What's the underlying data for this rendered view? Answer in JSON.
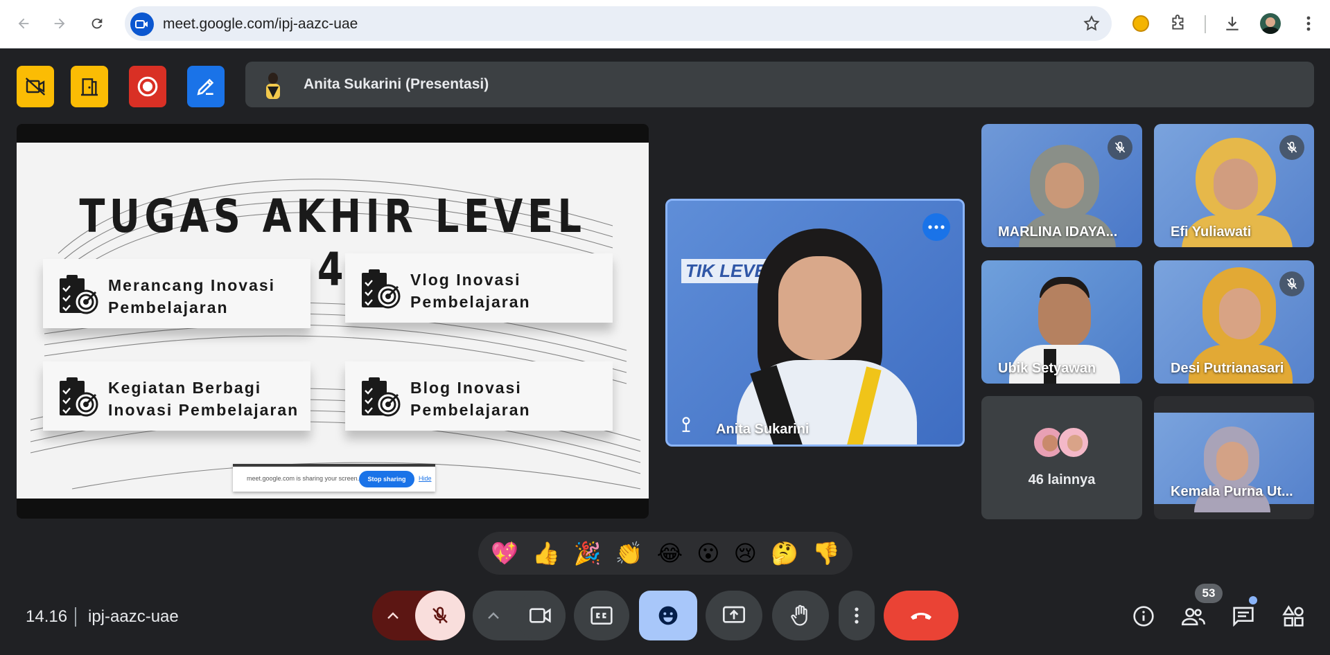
{
  "browser": {
    "url": "meet.google.com/ipj-aazc-uae"
  },
  "meeting": {
    "presenting_label": "Anita Sukarini (Presentasi)",
    "time": "14.16",
    "code": "ipj-aazc-uae",
    "participant_count": "53"
  },
  "slide": {
    "title": "TUGAS AKHIR LEVEL 4",
    "cards": [
      {
        "line1": "Merancang Inovasi",
        "line2": "Pembelajaran"
      },
      {
        "line1": "Vlog Inovasi",
        "line2": "Pembelajaran"
      },
      {
        "line1": "Kegiatan Berbagi",
        "line2": "Inovasi Pembelajaran"
      },
      {
        "line1": "Blog Inovasi",
        "line2": "Pembelajaran"
      }
    ],
    "share_bar": {
      "message": "meet.google.com is sharing your screen.",
      "stop": "Stop sharing",
      "hide": "Hide"
    }
  },
  "participants": {
    "main": "Anita Sukarini",
    "tiles": [
      "MARLINA IDAYA...",
      "Efi Yuliawati",
      "Ubik Setyawan",
      "Desi Putrianasari",
      "46 lainnya",
      "Kemala Purna Ut..."
    ]
  },
  "reactions": [
    "💖",
    "👍",
    "🎉",
    "👏",
    "😂",
    "😮",
    "😢",
    "🤔",
    "👎"
  ],
  "colors": {
    "meet_bg": "#202124",
    "end_call": "#ea4335",
    "mic_off": "#f9dedc",
    "emoji_active": "#a8c7fa",
    "host_yellow": "#fbbc04",
    "host_red": "#d93025",
    "host_blue": "#1a73e8"
  }
}
